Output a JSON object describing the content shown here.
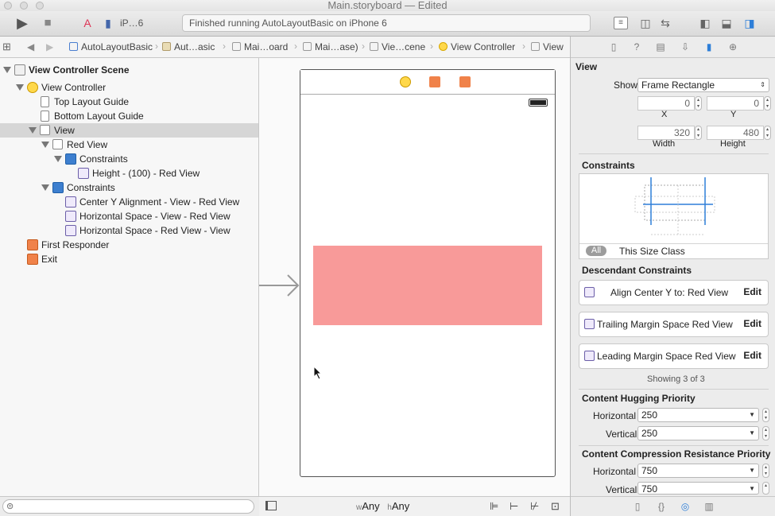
{
  "window": {
    "title": "Main.storyboard — Edited"
  },
  "toolbar": {
    "scheme": "iP…6",
    "status": "Finished running AutoLayoutBasic on iPhone 6"
  },
  "breadcrumb": [
    "AutoLayoutBasic",
    "Aut…asic",
    "Mai…oard",
    "Mai…ase)",
    "Vie…cene",
    "View Controller",
    "View"
  ],
  "outline": {
    "items": [
      {
        "label": "View Controller Scene"
      },
      {
        "label": "View Controller"
      },
      {
        "label": "Top Layout Guide"
      },
      {
        "label": "Bottom Layout Guide"
      },
      {
        "label": "View"
      },
      {
        "label": "Red View"
      },
      {
        "label": "Constraints"
      },
      {
        "label": "Height - (100) - Red View"
      },
      {
        "label": "Constraints"
      },
      {
        "label": "Center Y Alignment - View - Red View"
      },
      {
        "label": "Horizontal Space - View - Red View"
      },
      {
        "label": "Horizontal Space - Red View - View"
      },
      {
        "label": "First Responder"
      },
      {
        "label": "Exit"
      }
    ]
  },
  "canvas": {
    "size_w": "Any",
    "size_h": "Any",
    "w_prefix": "w",
    "h_prefix": "h",
    "red_color": "#f89a99"
  },
  "inspector": {
    "section_title": "View",
    "show_label": "Show",
    "show_value": "Frame Rectangle",
    "x": "0",
    "y": "0",
    "width": "320",
    "height": "480",
    "x_label": "X",
    "y_label": "Y",
    "width_label": "Width",
    "height_label": "Height",
    "constraints_title": "Constraints",
    "all_label": "All",
    "size_class_label": "This Size Class",
    "descendant_title": "Descendant Constraints",
    "descendants": [
      {
        "text": "Align Center Y to:  Red View",
        "edit": "Edit"
      },
      {
        "text": "Trailing Margin Space  Red View",
        "edit": "Edit"
      },
      {
        "text": "Leading Margin Space  Red View",
        "edit": "Edit"
      }
    ],
    "showing": "Showing 3 of 3",
    "hugging_title": "Content Hugging Priority",
    "hugging_h_label": "Horizontal",
    "hugging_h": "250",
    "hugging_v_label": "Vertical",
    "hugging_v": "250",
    "resist_title": "Content Compression Resistance Priority",
    "resist_h_label": "Horizontal",
    "resist_h": "750",
    "resist_v_label": "Vertical",
    "resist_v": "750"
  }
}
